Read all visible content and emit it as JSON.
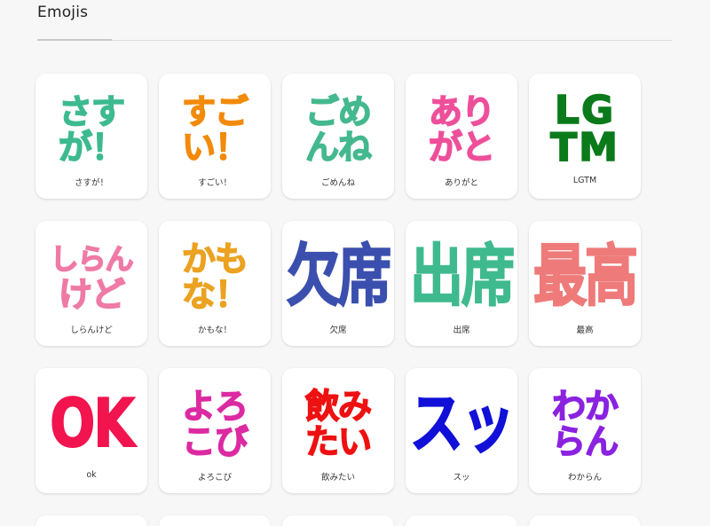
{
  "header": {
    "title": "Emojis"
  },
  "emojis": [
    {
      "lines": [
        "さす",
        "が！"
      ],
      "caption": "さすが！",
      "color": "#3dba8f"
    },
    {
      "lines": [
        "すご",
        "い！"
      ],
      "caption": "すごい！",
      "color": "#f28a0a"
    },
    {
      "lines": [
        "ごめ",
        "んね"
      ],
      "caption": "ごめんね",
      "color": "#44b88e"
    },
    {
      "lines": [
        "あり",
        "がと"
      ],
      "caption": "ありがと",
      "color": "#ee4f9a"
    },
    {
      "lines": [
        "LG",
        "TM"
      ],
      "caption": "LGTM",
      "color": "#0a7a1a"
    },
    {
      "lines": [
        "しらん",
        "けど"
      ],
      "caption": "しらんけど",
      "color": "#ef7aa6"
    },
    {
      "lines": [
        "かも",
        "な！"
      ],
      "caption": "かもな！",
      "color": "#eba220"
    },
    {
      "lines": [
        "欠席"
      ],
      "caption": "欠席",
      "color": "#3b4fae"
    },
    {
      "lines": [
        "出席"
      ],
      "caption": "出席",
      "color": "#3fba8e"
    },
    {
      "lines": [
        "最高"
      ],
      "caption": "最高",
      "color": "#ef7a7a"
    },
    {
      "lines": [
        "OK"
      ],
      "caption": "ok",
      "color": "#f2144e"
    },
    {
      "lines": [
        "よろ",
        "こび"
      ],
      "caption": "よろこび",
      "color": "#dc2aa2"
    },
    {
      "lines": [
        "飲み",
        "たい"
      ],
      "caption": "飲みたい",
      "color": "#ee1111"
    },
    {
      "lines": [
        "スッ"
      ],
      "caption": "スッ",
      "color": "#1010d8"
    },
    {
      "lines": [
        "わか",
        "らん"
      ],
      "caption": "わからん",
      "color": "#8a22e0"
    }
  ]
}
